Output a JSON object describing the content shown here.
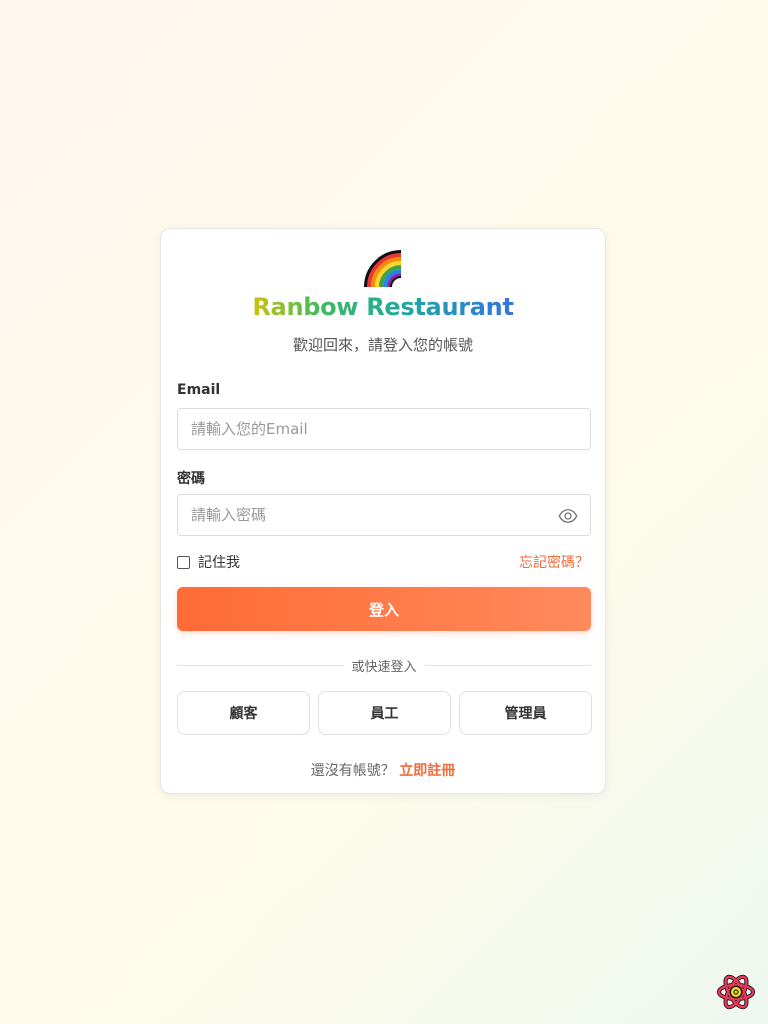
{
  "header": {
    "logo_icon": "rainbow-icon",
    "title": "Ranbow Restaurant",
    "subtitle": "歡迎回來，請登入您的帳號"
  },
  "form": {
    "email_label": "Email",
    "email_placeholder": "請輸入您的Email",
    "password_label": "密碼",
    "password_placeholder": "請輸入密碼",
    "password_toggle_icon": "eye-icon",
    "remember_label": "記住我",
    "forgot_label": "忘記密碼？",
    "login_button": "登入"
  },
  "quick_login": {
    "divider_text": "或快速登入",
    "buttons": [
      "顧客",
      "員工",
      "管理員"
    ]
  },
  "footer": {
    "prompt": "還沒有帳號？",
    "signup_link": "立即註冊"
  },
  "corner": {
    "icon": "react-atom-icon"
  },
  "colors": {
    "accent": "#ff6b35",
    "accent_light": "#ff8a5c",
    "link": "#f26b3a"
  }
}
